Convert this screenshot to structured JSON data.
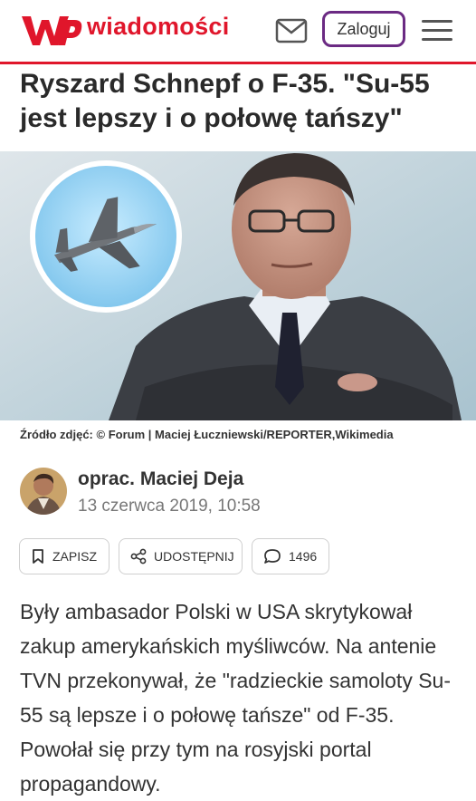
{
  "header": {
    "brand": "wiadomości",
    "login_label": "Zaloguj",
    "icons": [
      "wp-logo",
      "mail-icon",
      "menu-icon"
    ],
    "accent_color": "#e0162b",
    "login_border_color": "#6b2a83"
  },
  "article": {
    "title": "Ryszard Schnepf o F-35. \"Su-55 jest lepszy i o połowę tańszy\"",
    "image_caption_label": "Źródło zdjęć:",
    "image_caption_source": "© Forum | Maciej Łuczniewski/REPORTER,Wikimedia",
    "author": "oprac. Maciej Deja",
    "date": "13 czerwca 2019, 10:58",
    "actions": {
      "save": "ZAPISZ",
      "share": "UDOSTĘPNIJ",
      "comments": "1496"
    },
    "lead": "Były ambasador Polski w USA skrytykował zakup amerykańskich myśliwców. Na antenie TVN przekonywał, że \"radzieckie samoloty Su-55 są lepsze i o połowę tańsze\" od F-35. Powołał się przy tym na rosyjski portal propagandowy."
  }
}
